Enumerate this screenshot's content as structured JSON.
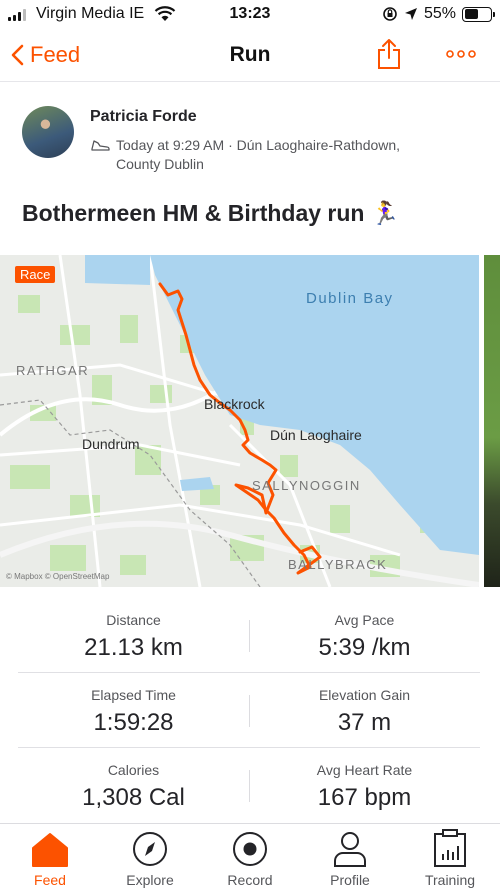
{
  "status_bar": {
    "carrier": "Virgin Media IE",
    "time": "13:23",
    "battery": "55%",
    "battery_level": 0.55
  },
  "nav": {
    "back_label": "Feed",
    "title": "Run",
    "more_label": "∘∘∘"
  },
  "athlete": {
    "name": "Patricia Forde",
    "meta": "Today at 9:29 AM · Dún Laoghaire-Rathdown, County Dublin"
  },
  "activity": {
    "title": "Bothermeen HM & Birthday run 🏃‍♀️"
  },
  "map": {
    "badge": "Race",
    "labels": {
      "dublin_bay": "Dublin Bay",
      "rathgar": "RATHGAR",
      "blackrock": "Blackrock",
      "dun_laoghaire": "Dún Laoghaire",
      "dundrum": "Dundrum",
      "sallynoggin": "SALLYNOGGIN",
      "ballybrack": "BALLYBRACK"
    },
    "attribution": "© Mapbox © OpenStreetMap"
  },
  "stats": [
    {
      "left": {
        "label": "Distance",
        "value": "21.13 km"
      },
      "right": {
        "label": "Avg Pace",
        "value": "5:39 /km"
      }
    },
    {
      "left": {
        "label": "Elapsed Time",
        "value": "1:59:28"
      },
      "right": {
        "label": "Elevation Gain",
        "value": "37 m"
      }
    },
    {
      "left": {
        "label": "Calories",
        "value": "1,308 Cal"
      },
      "right": {
        "label": "Avg Heart Rate",
        "value": "167 bpm"
      }
    }
  ],
  "tabs": [
    {
      "label": "Feed",
      "icon": "home-icon",
      "active": true
    },
    {
      "label": "Explore",
      "icon": "compass-icon",
      "active": false
    },
    {
      "label": "Record",
      "icon": "record-icon",
      "active": false
    },
    {
      "label": "Profile",
      "icon": "profile-icon",
      "active": false
    },
    {
      "label": "Training",
      "icon": "training-icon",
      "active": false
    }
  ],
  "colors": {
    "accent": "#fc5200",
    "route": "#fc5200",
    "water": "#abd4ef",
    "park": "#c5e6b2"
  }
}
